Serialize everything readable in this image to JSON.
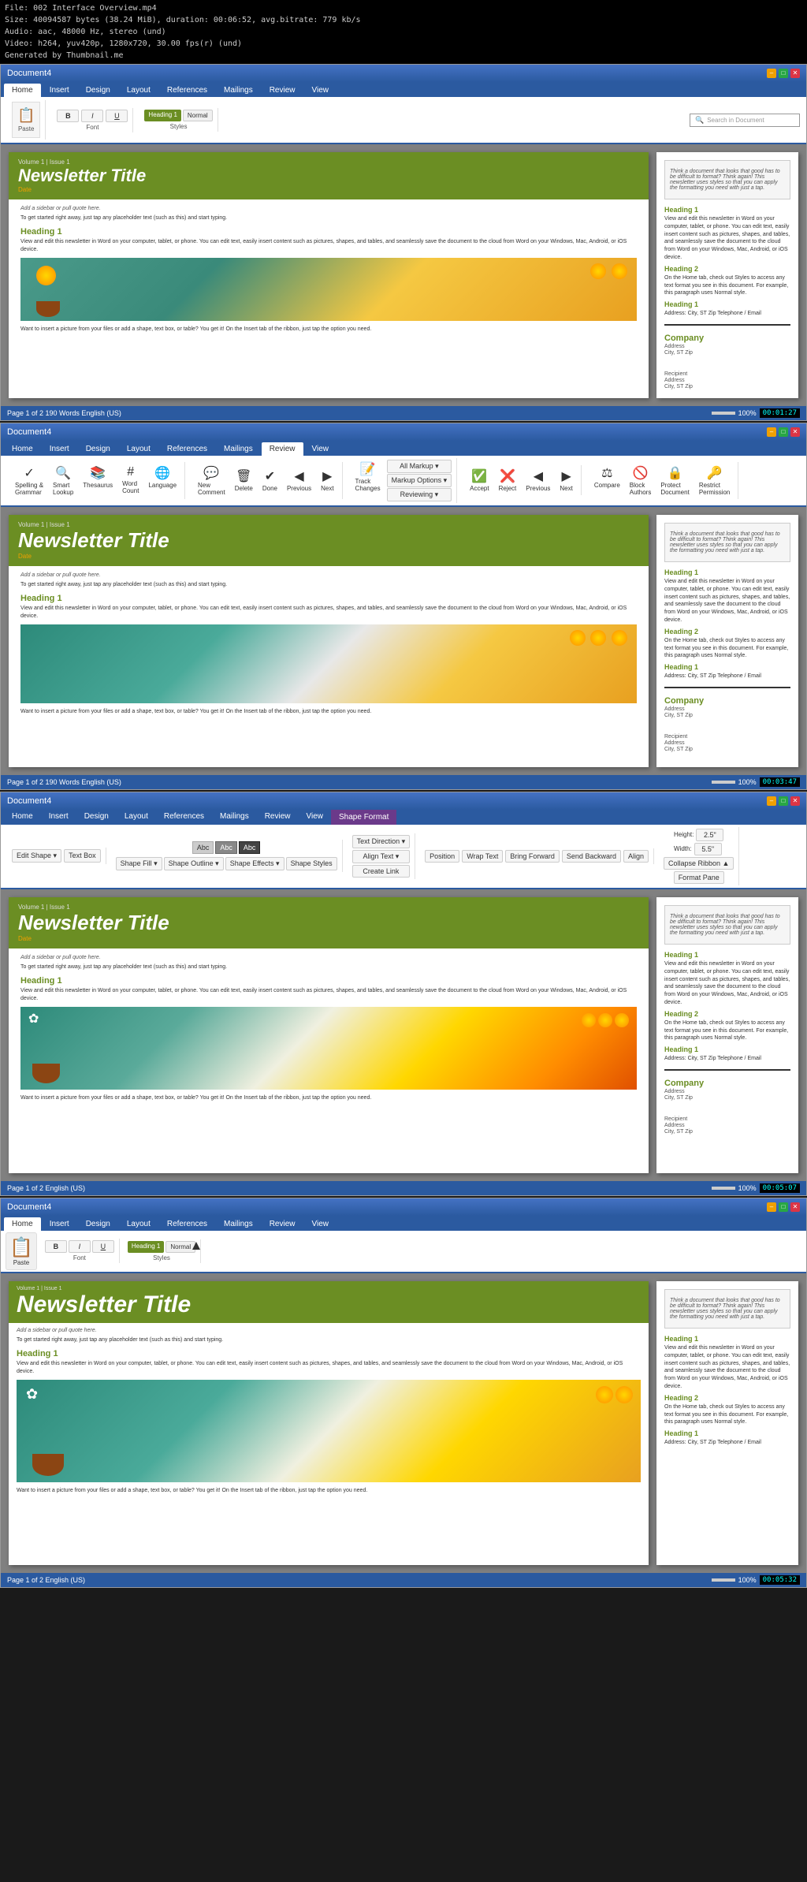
{
  "media_info": {
    "file": "File: 002 Interface Overview.mp4",
    "size": "Size: 40094587 bytes (38.24 MiB), duration: 00:06:52, avg.bitrate: 779 kb/s",
    "audio": "Audio: aac, 48000 Hz, stereo (und)",
    "video": "Video: h264, yuv420p, 1280x720, 30.00 fps(r) (und)",
    "generated": "Generated by Thumbnail.me"
  },
  "window1": {
    "title": "Document4",
    "tabs": [
      "Home",
      "Insert",
      "Design",
      "Layout",
      "References",
      "Mailings",
      "Review",
      "View"
    ],
    "active_tab": "Home",
    "status": "Page 1 of 2   190 Words   English (US)",
    "timestamp": "00:01:27"
  },
  "window2": {
    "title": "Document4",
    "tabs": [
      "Home",
      "Insert",
      "Design",
      "Layout",
      "References",
      "Mailings",
      "Review",
      "View"
    ],
    "active_tab": "Review",
    "review_buttons": [
      "Spelling & Grammar",
      "Smart Lookup",
      "Thesaurus",
      "Word Count",
      "Language",
      "New Comment",
      "Delete",
      "Done",
      "Previous",
      "Next",
      "Track Changes",
      "All Markup",
      "Markup Options",
      "Reviewing",
      "Accept",
      "Reject",
      "Previous",
      "Next",
      "Compare",
      "Block Authors",
      "Protect Document",
      "Restrict Permission"
    ],
    "status": "Page 1 of 2   190 Words   English (US)",
    "timestamp": "00:03:47"
  },
  "window3": {
    "title": "Document4",
    "tabs": [
      "Home",
      "Insert",
      "Design",
      "Layout",
      "References",
      "Mailings",
      "Review",
      "View"
    ],
    "shape_format_tab": "Shape Format",
    "active_tab": "Shape Format",
    "shape_tools": [
      "Edit Shape",
      "Text Box",
      "Abc",
      "Abc",
      "Abc",
      "Shape Fill",
      "Shape Outline",
      "Shape Effects",
      "Shape Styles",
      "Align Text",
      "Create Link",
      "Position",
      "Wrap Text",
      "Bring Forward",
      "Send Backward",
      "Align"
    ],
    "properties": {
      "height_label": "Height:",
      "height_value": "2.5\"",
      "width_label": "Width:",
      "width_value": "5.5\""
    },
    "status": "Page 1 of 2   English (US)",
    "timestamp": "00:05:07"
  },
  "window4": {
    "title": "Document4 (partially visible)",
    "tabs": [
      "Home",
      "Insert",
      "Design",
      "Layout",
      "References",
      "Mailings",
      "Review",
      "View"
    ],
    "active_tab": "Home",
    "timestamp": "00:05:32"
  },
  "newsletter": {
    "volume": "Volume 1 | Issue 1",
    "date": "Date",
    "title": "Newsletter Title",
    "subtitle_placeholder": "To get started right away, just tap any placeholder text (such as this) and start typing.",
    "sidebar_placeholder": "Add a sidebar or pull quote here.",
    "heading1": "Heading 1",
    "heading1_body": "View and edit this newsletter in Word on your computer, tablet, or phone. You can edit text, easily insert content such as pictures, shapes, and tables, and seamlessly save the document to the cloud from Word on your Windows, Mac, Android, or iOS device.",
    "heading2": "Heading 2",
    "heading2_body": "On the Home tab, check out Styles to access any text format you see in this document. For example, this paragraph uses Normal style.",
    "heading3": "Heading 1",
    "heading3_body": "Address: City, ST Zip\nTelephone / Email",
    "image_caption": "Want to insert a picture from your files or add a shape, text box, or table? You get it! On the Insert tab of the ribbon, just tap the option you need.",
    "right_panel_think": "Think a document that looks that good has to be difficult to format? Think again! This newsletter uses styles so that you can apply the formatting you need with just a tap.",
    "company": "Company",
    "company_address": "Address",
    "company_city": "City, ST Zip",
    "recipient_label": "Recipient",
    "recipient_address": "Address",
    "recipient_city": "City, ST Zip"
  },
  "colors": {
    "green_header": "#6b8e23",
    "blue_ribbon": "#2b5aa0",
    "orange_date": "#f0a000",
    "body_text": "#333333",
    "light_gray_bg": "#808080"
  }
}
